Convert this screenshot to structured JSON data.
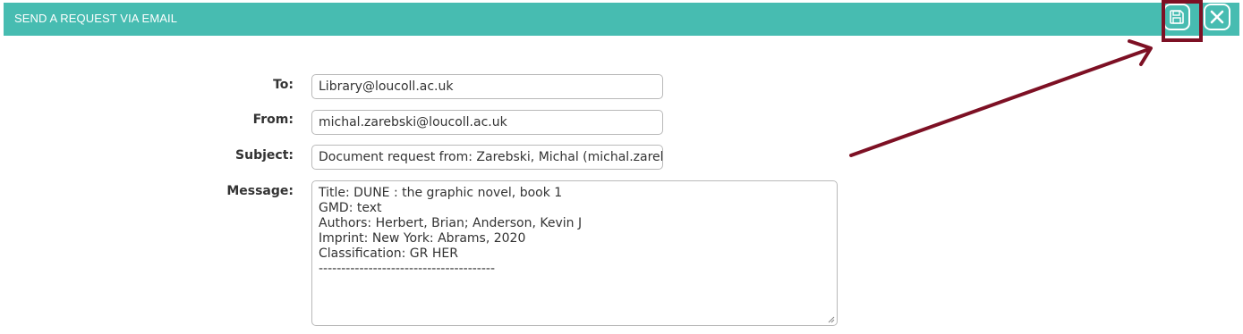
{
  "header": {
    "title": "SEND A REQUEST VIA EMAIL",
    "save_icon": "save-icon",
    "close_icon": "close-icon",
    "color": "#47bcb1"
  },
  "annotation": {
    "color": "#7d1024"
  },
  "form": {
    "to": {
      "label": "To:",
      "value": "Library@loucoll.ac.uk"
    },
    "from": {
      "label": "From:",
      "value": "michal.zarebski@loucoll.ac.uk"
    },
    "subject": {
      "label": "Subject:",
      "value": "Document request from: Zarebski, Michal (michal.zareb"
    },
    "message": {
      "label": "Message:",
      "lines": [
        "Title: DUNE : the graphic novel, book 1",
        "GMD: text",
        "Authors: Herbert, Brian; Anderson, Kevin J",
        "Imprint: New York: Abrams, 2020",
        "Classification: GR HER",
        "---------------------------------------"
      ]
    }
  }
}
